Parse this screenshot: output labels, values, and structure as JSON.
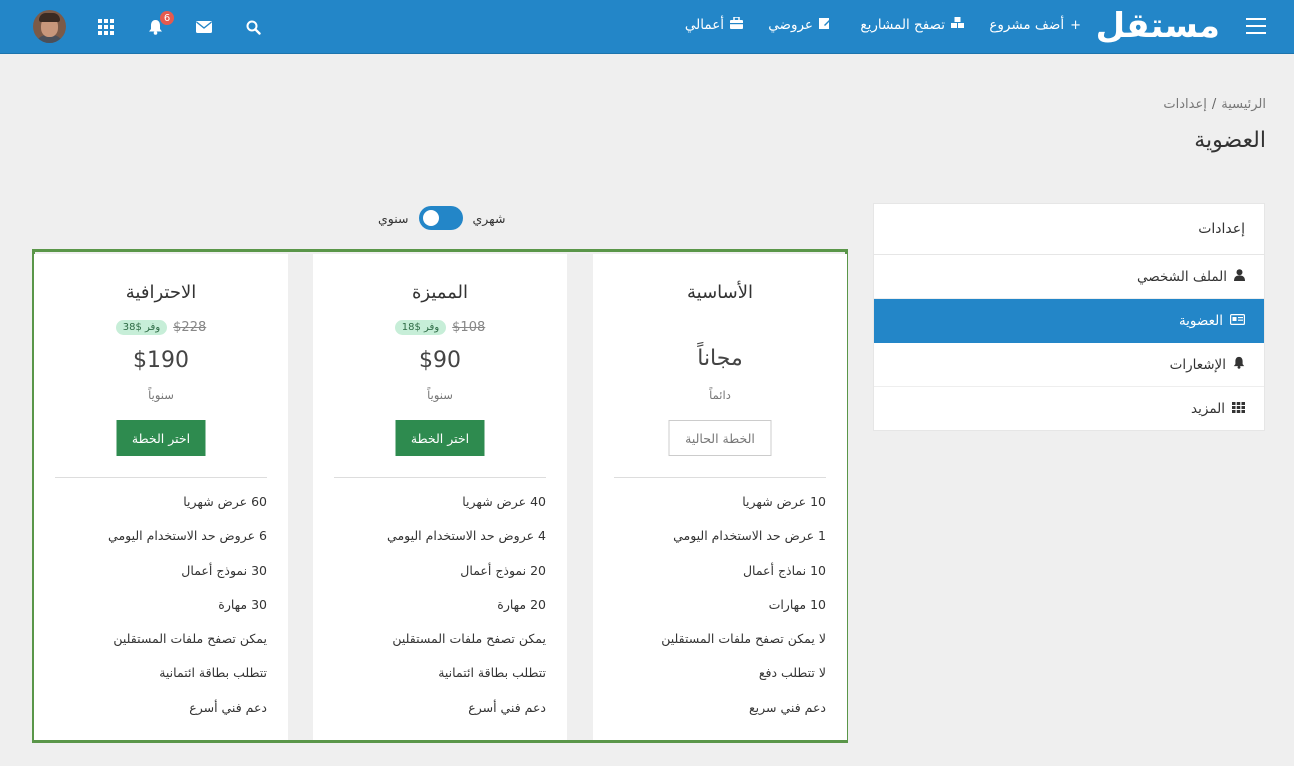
{
  "navbar": {
    "logo": "مستقل",
    "links": [
      {
        "label": "أضف مشروع",
        "icon": "plus-icon"
      },
      {
        "label": "تصفح المشاريع",
        "icon": "cubes-icon"
      },
      {
        "label": "عروضي",
        "icon": "edit-icon"
      },
      {
        "label": "أعمالي",
        "icon": "briefcase-icon"
      }
    ],
    "notifications_count": "6",
    "colors": {
      "bar": "#2386c8",
      "badge": "#e55a4e"
    }
  },
  "breadcrumb": {
    "home": "الرئيسية",
    "separator": "/",
    "current": "إعدادات"
  },
  "page_title": "العضوية",
  "sidebar": {
    "header": "إعدادات",
    "items": [
      {
        "label": "الملف الشخصي",
        "icon": "user-icon",
        "active": false
      },
      {
        "label": "العضوية",
        "icon": "id-card-icon",
        "active": true
      },
      {
        "label": "الإشعارات",
        "icon": "bell-icon",
        "active": false
      },
      {
        "label": "المزيد",
        "icon": "grid-icon",
        "active": false
      }
    ]
  },
  "billing_toggle": {
    "monthly": "شهري",
    "yearly": "سنوي"
  },
  "plans": [
    {
      "name": "الأساسية",
      "price": "مجاناً",
      "period": "دائماً",
      "button": "الخطة الحالية",
      "features": [
        "10 عرض شهريا",
        "1 عرض حد الاستخدام اليومي",
        "10 نماذج أعمال",
        "10 مهارات",
        "لا يمكن تصفح ملفات المستقلين",
        "لا تتطلب دفع",
        "دعم فني سريع"
      ]
    },
    {
      "name": "المميزة",
      "old_price": "$108",
      "save": "وفر $18",
      "price": "$90",
      "period": "سنوياً",
      "button": "اختر الخطة",
      "features": [
        "40 عرض شهريا",
        "4 عروض حد الاستخدام اليومي",
        "20 نموذج أعمال",
        "20 مهارة",
        "يمكن تصفح ملفات المستقلين",
        "تتطلب بطاقة ائتمانية",
        "دعم فني أسرع"
      ]
    },
    {
      "name": "الاحترافية",
      "old_price": "$228",
      "save": "وفر $38",
      "price": "$190",
      "period": "سنوياً",
      "button": "اختر الخطة",
      "features": [
        "60 عرض شهريا",
        "6 عروض حد الاستخدام اليومي",
        "30 نموذج أعمال",
        "30 مهارة",
        "يمكن تصفح ملفات المستقلين",
        "تتطلب بطاقة ائتمانية",
        "دعم فني أسرع"
      ]
    }
  ]
}
